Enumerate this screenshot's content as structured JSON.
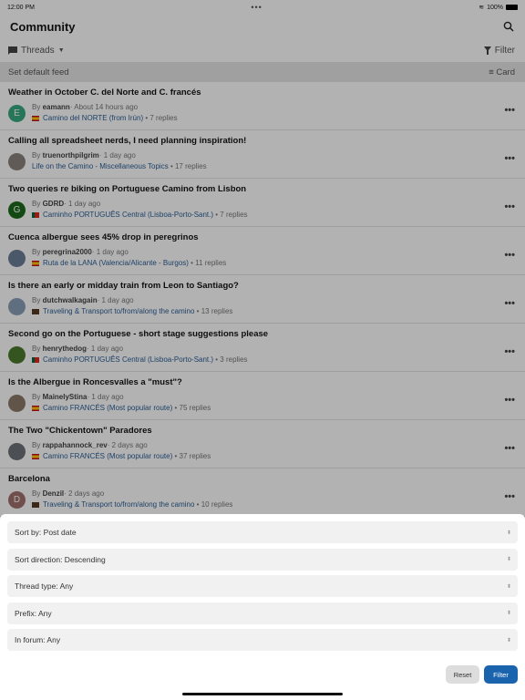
{
  "status": {
    "time": "12:00 PM",
    "battery": "100%"
  },
  "header": {
    "title": "Community",
    "search_icon": "search-icon"
  },
  "subbar": {
    "threads_label": "Threads",
    "filter_label": "Filter"
  },
  "feedbar": {
    "set_default": "Set default feed",
    "view_label": "Card"
  },
  "threads": [
    {
      "title": "Weather in October C. del Norte and C. francés",
      "author": "eamann",
      "time": "About 14 hours ago",
      "forum": "Camino del NORTE (from Irún)",
      "replies": "7 replies",
      "avatar": "E",
      "avatar_color": "#3aa981",
      "flag": "spain"
    },
    {
      "title": "Calling all spreadsheet nerds, I need planning inspiration!",
      "author": "truenorthpilgrim",
      "time": "1 day ago",
      "forum": "Life on the Camino - Miscellaneous Topics",
      "replies": "17 replies",
      "avatar": "",
      "avatar_color": "#8a837c",
      "flag": ""
    },
    {
      "title": "Two queries re biking on Portuguese Camino from Lisbon",
      "author": "GDRD",
      "time": "1 day ago",
      "forum": "Caminho PORTUGUÊS Central (Lisboa-Porto-Sant.)",
      "replies": "7 replies",
      "avatar": "G",
      "avatar_color": "#1c6b1c",
      "flag": "portugal"
    },
    {
      "title": "Cuenca albergue sees 45% drop in peregrinos",
      "author": "peregrina2000",
      "time": "1 day ago",
      "forum": "Ruta de la LANA (Valencia/Alicante - Burgos)",
      "replies": "11 replies",
      "avatar": "",
      "avatar_color": "#6b7f97",
      "flag": "spain"
    },
    {
      "title": "Is there an early or midday train from Leon to Santiago?",
      "author": "dutchwalkagain",
      "time": "1 day ago",
      "forum": "Traveling & Transport to/from/along the camino",
      "replies": "13 replies",
      "avatar": "",
      "avatar_color": "#8aa0b8",
      "flag": "suitcase"
    },
    {
      "title": "Second go on the Portuguese - short stage suggestions please",
      "author": "henrythedog",
      "time": "1 day ago",
      "forum": "Caminho PORTUGUÊS Central (Lisboa-Porto-Sant.)",
      "replies": "3 replies",
      "avatar": "",
      "avatar_color": "#4d7a2e",
      "flag": "portugal"
    },
    {
      "title": "Is the Albergue in Roncesvalles a \"must\"?",
      "author": "MainelyStina",
      "time": "1 day ago",
      "forum": "Camino FRANCÉS (Most popular route)",
      "replies": "75 replies",
      "avatar": "",
      "avatar_color": "#8a7a68",
      "flag": "spain"
    },
    {
      "title": "The Two \"Chickentown\" Paradores",
      "author": "rappahannock_rev",
      "time": "2 days ago",
      "forum": "Camino FRANCÉS (Most popular route)",
      "replies": "37 replies",
      "avatar": "",
      "avatar_color": "#6d7278",
      "flag": "spain"
    },
    {
      "title": "Barcelona",
      "author": "Denzil",
      "time": "2 days ago",
      "forum": "Traveling & Transport to/from/along the camino",
      "replies": "10 replies",
      "avatar": "D",
      "avatar_color": "#a0706c",
      "flag": "suitcase"
    }
  ],
  "by": "By",
  "filters": [
    {
      "label": "Sort by: Post date"
    },
    {
      "label": "Sort direction: Descending"
    },
    {
      "label": "Thread type: Any"
    },
    {
      "label": "Prefix: Any"
    },
    {
      "label": "In forum: Any"
    }
  ],
  "buttons": {
    "reset": "Reset",
    "filter": "Filter"
  },
  "colors": {
    "accent": "#1a64ae",
    "link": "#2a5e95"
  }
}
